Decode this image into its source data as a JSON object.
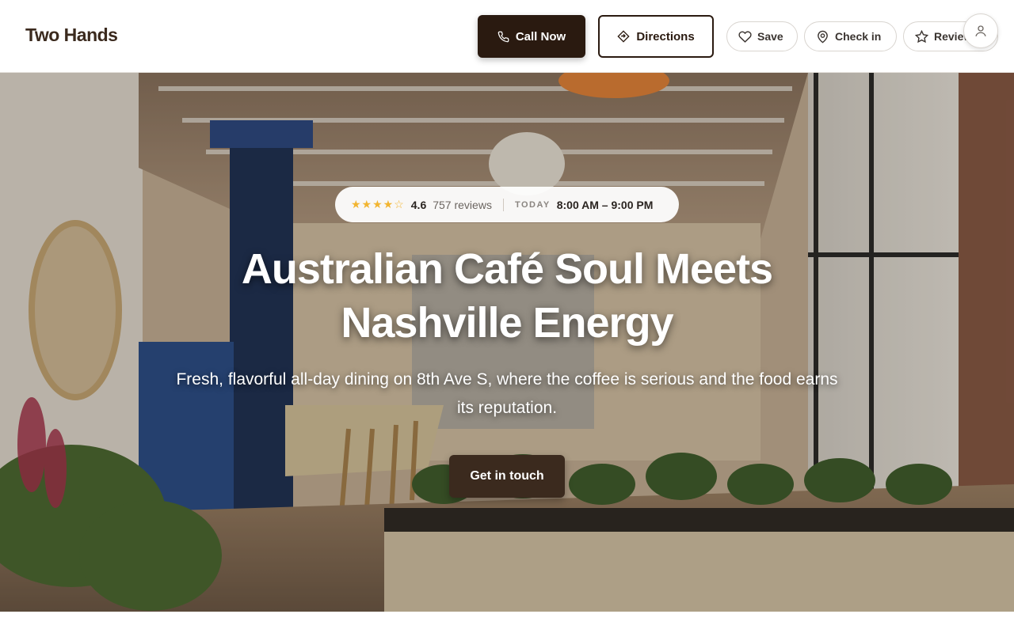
{
  "header": {
    "brand": "Two Hands",
    "call_label": "Call Now",
    "directions_label": "Directions",
    "save_label": "Save",
    "checkin_label": "Check in",
    "review_label": "Review"
  },
  "hero": {
    "stars": "★★★★☆",
    "rating": "4.6",
    "reviews": "757 reviews",
    "today_label": "TODAY",
    "hours": "8:00 AM – 9:00 PM",
    "title": "Australian Café Soul Meets Nashville Energy",
    "subtitle": "Fresh, flavorful all-day dining on 8th Ave S, where the coffee is serious and the food earns its reputation.",
    "cta_label": "Get in touch"
  },
  "colors": {
    "brand_dark": "#2a1a10",
    "cta_brown": "#3b2a1e",
    "star": "#f2b531"
  },
  "icons": [
    "phone-icon",
    "directions-icon",
    "heart-icon",
    "location-pin-icon",
    "star-icon",
    "user-icon"
  ]
}
